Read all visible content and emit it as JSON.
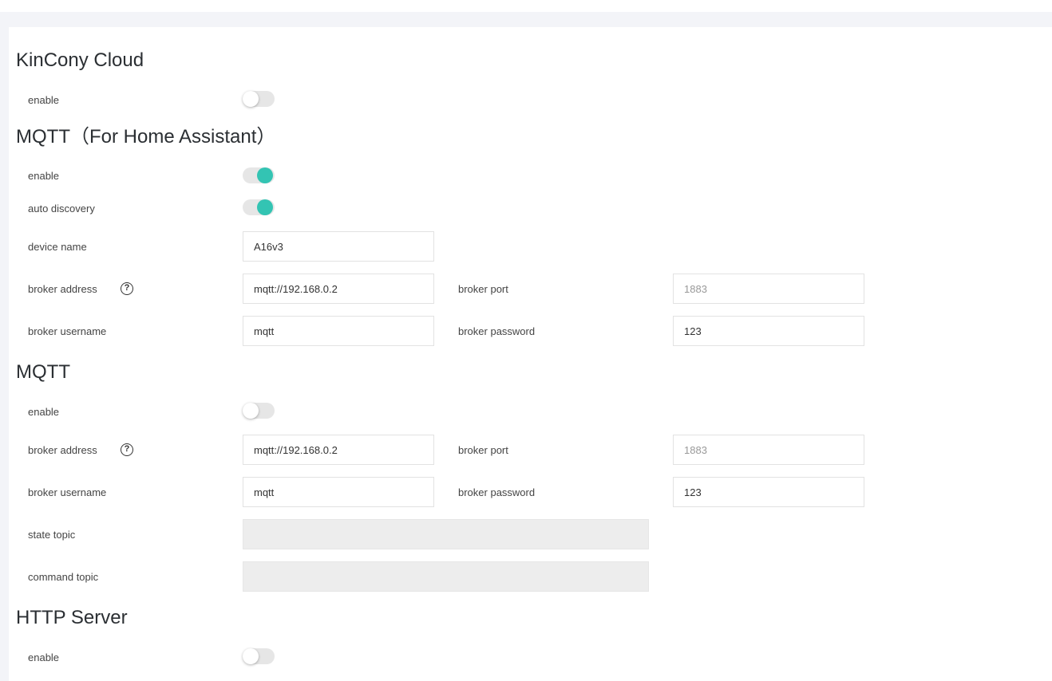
{
  "kincony": {
    "title": "KinCony Cloud",
    "enable_label": "enable",
    "enabled": false
  },
  "mqtt_ha": {
    "title": "MQTT（For Home Assistant）",
    "enable_label": "enable",
    "enabled": true,
    "auto_label": "auto discovery",
    "auto_discovery": true,
    "device_name_label": "device name",
    "device_name": "A16v3",
    "broker_address_label": "broker address",
    "broker_address": "mqtt://192.168.0.2",
    "broker_port_label": "broker port",
    "broker_port_placeholder": "1883",
    "broker_username_label": "broker username",
    "broker_username": "mqtt",
    "broker_password_label": "broker password",
    "broker_password": "123"
  },
  "mqtt": {
    "title": "MQTT",
    "enable_label": "enable",
    "enabled": false,
    "broker_address_label": "broker address",
    "broker_address": "mqtt://192.168.0.2",
    "broker_port_label": "broker port",
    "broker_port_placeholder": "1883",
    "broker_username_label": "broker username",
    "broker_username": "mqtt",
    "broker_password_label": "broker password",
    "broker_password": "123",
    "state_topic_label": "state topic",
    "state_topic": "",
    "command_topic_label": "command topic",
    "command_topic": ""
  },
  "http": {
    "title": "HTTP Server",
    "enable_label": "enable",
    "enabled": false
  },
  "help_glyph": "?",
  "accent": "#33c4b3"
}
